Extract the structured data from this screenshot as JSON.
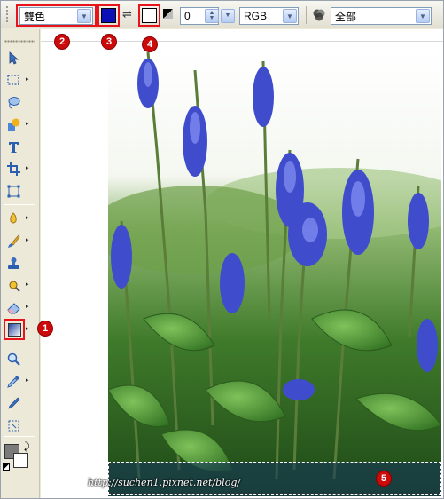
{
  "toolbar": {
    "fill_type": "雙色",
    "opacity_value": "0",
    "color_mode": "RGB",
    "channel": "全部"
  },
  "colors": {
    "foreground": "#0b0fb8",
    "background": "#ffffff",
    "highlight": "#e8141c",
    "badge": "#cc0a0a"
  },
  "badges": [
    "1",
    "2",
    "3",
    "4",
    "5"
  ],
  "tools": [
    {
      "icon": "pointer-icon"
    },
    {
      "icon": "marquee-select-icon"
    },
    {
      "icon": "lasso-icon"
    },
    {
      "icon": "shape-icon"
    },
    {
      "icon": "text-icon"
    },
    {
      "icon": "crop-icon"
    },
    {
      "icon": "transform-icon"
    },
    {
      "icon": "smudge-icon"
    },
    {
      "icon": "paintbrush-icon"
    },
    {
      "icon": "clone-stamp-icon"
    },
    {
      "icon": "dodge-icon"
    },
    {
      "icon": "eraser-icon"
    },
    {
      "icon": "gradient-fill-icon"
    },
    {
      "icon": "zoom-icon"
    },
    {
      "icon": "eyedropper-icon"
    },
    {
      "icon": "pen-icon"
    },
    {
      "icon": "hand-icon"
    }
  ],
  "watermark": "http://suchen1.pixnet.net/blog/"
}
